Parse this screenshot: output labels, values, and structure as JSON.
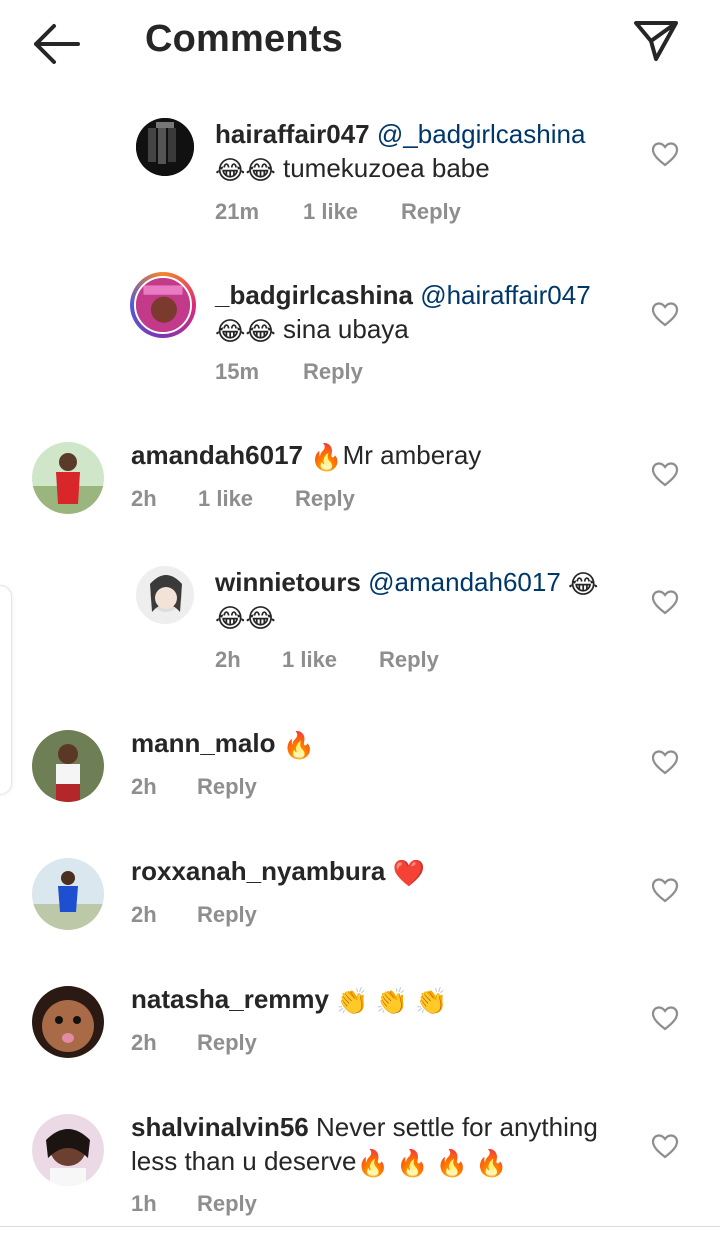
{
  "header": {
    "title": "Comments",
    "back_icon": "arrow-left-icon",
    "send_icon": "paper-plane-icon"
  },
  "comments": [
    {
      "user": "hairaffair047",
      "mention": "@_badgirlcashina",
      "text": " tumekuzoea babe",
      "emoji_inline": "",
      "emoji_line2": "😂😂",
      "time": "21m",
      "likes": "1 like",
      "reply": "Reply"
    },
    {
      "user": "_badgirlcashina",
      "mention": "@hairaffair047",
      "text": " sina ubaya",
      "emoji_line2": "😂😂",
      "time": "15m",
      "reply": "Reply"
    },
    {
      "user": "amandah6017",
      "emoji": "🔥",
      "text": "Mr amberay",
      "time": "2h",
      "likes": "1 like",
      "reply": "Reply"
    },
    {
      "user": "winnietours",
      "mention": "@amandah6017",
      "emoji": "😂",
      "emoji_line2": "😂😂",
      "time": "2h",
      "likes": "1 like",
      "reply": "Reply"
    },
    {
      "user": "mann_malo",
      "emoji": "🔥",
      "time": "2h",
      "reply": "Reply"
    },
    {
      "user": "roxxanah_nyambura",
      "emoji": "❤️",
      "time": "2h",
      "reply": "Reply"
    },
    {
      "user": "natasha_remmy",
      "emoji": "👏 👏 👏",
      "time": "2h",
      "reply": "Reply"
    },
    {
      "user": "shalvinalvin56",
      "text_line1": "Never settle for anything",
      "text_line2": "less than u deserve",
      "emoji": "🔥 🔥 🔥 🔥",
      "time": "1h",
      "reply": "Reply"
    }
  ],
  "colors": {
    "username": "#262626",
    "mention": "#00376b",
    "meta": "#8e8e8e"
  }
}
